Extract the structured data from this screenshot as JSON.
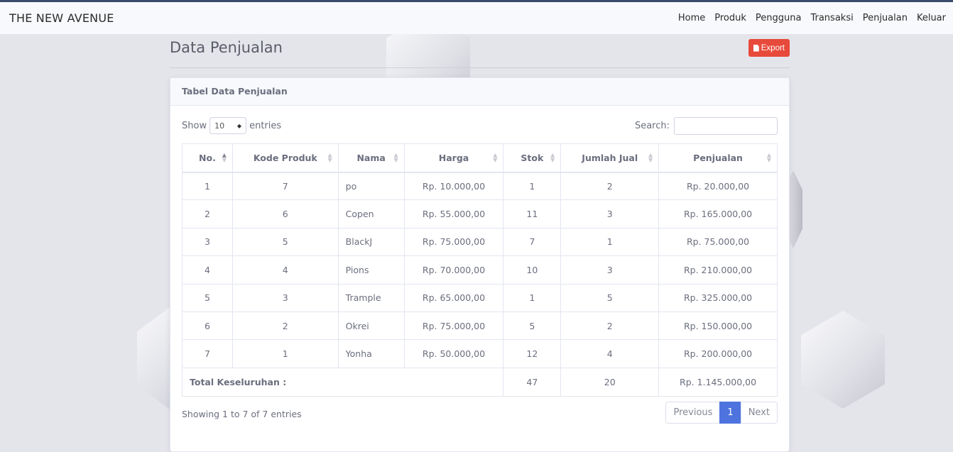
{
  "navbar": {
    "brand": "THE NEW AVENUE",
    "links": [
      "Home",
      "Produk",
      "Pengguna",
      "Transaksi",
      "Penjualan",
      "Keluar"
    ]
  },
  "page": {
    "title": "Data Penjualan",
    "export_label": "Export",
    "export_color": "#e74a3b"
  },
  "card": {
    "title": "Tabel Data Penjualan",
    "show_label": "Show",
    "entries_value": "10",
    "entries_label": "entries",
    "search_label": "Search:",
    "search_value": ""
  },
  "table": {
    "headers": [
      "No.",
      "Kode Produk",
      "Nama",
      "Harga",
      "Stok",
      "Jumlah Jual",
      "Penjualan"
    ],
    "rows": [
      [
        "1",
        "7",
        "po",
        "Rp. 10.000,00",
        "1",
        "2",
        "Rp. 20.000,00"
      ],
      [
        "2",
        "6",
        "Copen",
        "Rp. 55.000,00",
        "11",
        "3",
        "Rp. 165.000,00"
      ],
      [
        "3",
        "5",
        "BlackJ",
        "Rp. 75.000,00",
        "7",
        "1",
        "Rp. 75.000,00"
      ],
      [
        "4",
        "4",
        "Pions",
        "Rp. 70.000,00",
        "10",
        "3",
        "Rp. 210.000,00"
      ],
      [
        "5",
        "3",
        "Trample",
        "Rp. 65.000,00",
        "1",
        "5",
        "Rp. 325.000,00"
      ],
      [
        "6",
        "2",
        "Okrei",
        "Rp. 75.000,00",
        "5",
        "2",
        "Rp. 150.000,00"
      ],
      [
        "7",
        "1",
        "Yonha",
        "Rp. 50.000,00",
        "12",
        "4",
        "Rp. 200.000,00"
      ]
    ],
    "footer": {
      "label": "Total Keseluruhan :",
      "stok": "47",
      "jumlah": "20",
      "penjualan": "Rp. 1.145.000,00"
    }
  },
  "pagination": {
    "info": "Showing 1 to 7 of 7 entries",
    "previous": "Previous",
    "current": "1",
    "next": "Next",
    "accent": "#4e73df"
  }
}
